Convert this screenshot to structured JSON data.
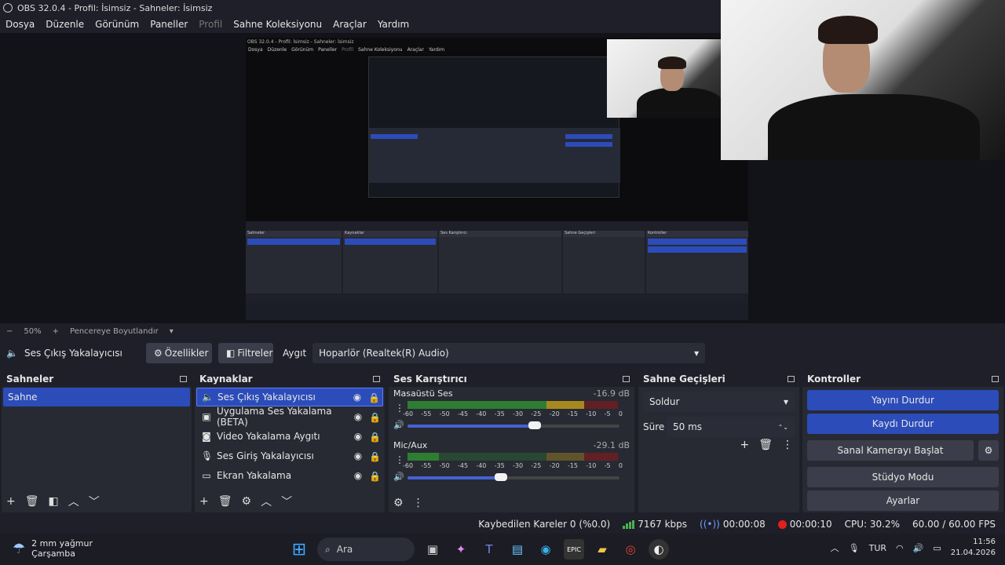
{
  "window": {
    "title": "OBS 32.0.4 - Profil: İsimsiz - Sahneler: İsimsiz"
  },
  "menu": [
    "Dosya",
    "Düzenle",
    "Görünüm",
    "Paneller",
    "Profil",
    "Sahne Koleksiyonu",
    "Araçlar",
    "Yardım"
  ],
  "nested": {
    "title": "OBS 32.0.4 - Profil: İsimsiz - Sahneler: İsimsiz",
    "menu": [
      "Dosya",
      "Düzenle",
      "Görünüm",
      "Paneller",
      "Profil",
      "Sahne Koleksiyonu",
      "Araçlar",
      "Yardım"
    ]
  },
  "zoom": {
    "minus": "−",
    "value": "50%",
    "plus": "+",
    "fit": "Pencereye Boyutlandır"
  },
  "source_bar": {
    "name": "Ses Çıkış Yakalayıcısı",
    "properties": "Özellikler",
    "filters": "Filtreler",
    "device_label": "Aygıt",
    "device_value": "Hoparlör (Realtek(R) Audio)"
  },
  "scenes": {
    "title": "Sahneler",
    "items": [
      "Sahne"
    ]
  },
  "sources": {
    "title": "Kaynaklar",
    "items": [
      {
        "label": "Ses Çıkış Yakalayıcısı",
        "icon": "speaker-icon"
      },
      {
        "label": "Uygulama Ses Yakalama (BETA)",
        "icon": "app-audio-icon"
      },
      {
        "label": "Video Yakalama Aygıtı",
        "icon": "camera-icon"
      },
      {
        "label": "Ses Giriş Yakalayıcısı",
        "icon": "microphone-icon"
      },
      {
        "label": "Ekran Yakalama",
        "icon": "monitor-icon"
      }
    ]
  },
  "mixer": {
    "title": "Ses Karıştırıcı",
    "scale": [
      "-60",
      "-55",
      "-50",
      "-45",
      "-40",
      "-35",
      "-30",
      "-25",
      "-20",
      "-15",
      "-10",
      "-5",
      "0"
    ],
    "channels": [
      {
        "name": "Masaüstü Ses",
        "db": "-16.9 dB",
        "level": 0.72,
        "volume": 0.6
      },
      {
        "name": "Mic/Aux",
        "db": "-29.1 dB",
        "level": 0.15,
        "volume": 0.44
      }
    ]
  },
  "transitions": {
    "title": "Sahne Geçişleri",
    "selected": "Soldur",
    "duration_label": "Süre",
    "duration_value": "50 ms"
  },
  "controls": {
    "title": "Kontroller",
    "stop_stream": "Yayını Durdur",
    "stop_record": "Kaydı Durdur",
    "virtual_cam": "Sanal Kamerayı Başlat",
    "studio_mode": "Stüdyo Modu",
    "settings": "Ayarlar"
  },
  "status": {
    "dropped": "Kaybedilen Kareler 0 (%0.0)",
    "bitrate": "7167 kbps",
    "stream_time": "00:00:08",
    "rec_time": "00:00:10",
    "cpu": "CPU: 30.2%",
    "fps": "60.00 / 60.00 FPS"
  },
  "taskbar": {
    "weather_line1": "2 mm yağmur",
    "weather_line2": "Çarşamba",
    "search": "Ara",
    "lang": "TUR",
    "time": "11:56",
    "date": "21.04.2026"
  },
  "colors": {
    "accent": "#2c4cba",
    "panel": "#272a33",
    "bg": "#1e1f29"
  }
}
